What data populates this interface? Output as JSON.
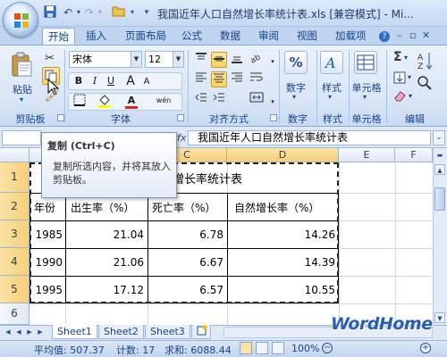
{
  "window": {
    "title": "我国近年人口自然增长率统计表.xls  [兼容模式] - Mi..."
  },
  "quick_access": {
    "icons": [
      "save-icon",
      "undo-icon",
      "redo-icon",
      "open-icon",
      "customize-icon"
    ]
  },
  "ribbon": {
    "tabs": [
      "开始",
      "插入",
      "页面布局",
      "公式",
      "数据",
      "审阅",
      "视图",
      "加载项"
    ],
    "active_tab": "开始",
    "clipboard": {
      "label": "剪贴板",
      "paste_label": "粘贴"
    },
    "font": {
      "label": "字体",
      "font_name": "宋体",
      "font_size": "12",
      "bold": "B",
      "italic": "I",
      "underline": "U",
      "font_color": "A",
      "wen": "wén"
    },
    "alignment": {
      "label": "对齐方式"
    },
    "number": {
      "label": "数字",
      "button": "数字",
      "symbol": "%"
    },
    "styles": {
      "label": "样式",
      "button": "样式"
    },
    "cells": {
      "label": "单元格",
      "button": "单元格"
    },
    "editing": {
      "label": "编辑",
      "sum": "Σ",
      "sort": "A"
    }
  },
  "formula_bar": {
    "fx": "fx",
    "content": "我国近年人口自然增长率统计表"
  },
  "tooltip": {
    "title": "复制 (Ctrl+C)",
    "body": "复制所选内容，并将其放入剪贴板。"
  },
  "sheet": {
    "columns": [
      "C",
      "D",
      "E",
      "F"
    ],
    "rows": [
      "1",
      "2",
      "3",
      "4",
      "5",
      "6"
    ],
    "title_fragment": "然增长率统计表",
    "headers": [
      "年份",
      "出生率（%）",
      "死亡率（%）",
      "自然增长率（%）"
    ],
    "data": [
      [
        "1985",
        "21.04",
        "6.78",
        "14.26"
      ],
      [
        "1990",
        "21.06",
        "6.67",
        "14.39"
      ],
      [
        "1995",
        "17.12",
        "6.57",
        "10.55"
      ]
    ]
  },
  "sheet_tabs": [
    "Sheet1",
    "Sheet2",
    "Sheet3"
  ],
  "status": {
    "average": "平均值: 507.37",
    "count": "计数: 17",
    "sum": "求和: 6088.44",
    "zoom": "100%"
  },
  "watermark": "WordHome",
  "colors": {
    "accent": "#15428b",
    "selected_header": "#f8cf76",
    "ribbon": "#dbe7f6"
  }
}
